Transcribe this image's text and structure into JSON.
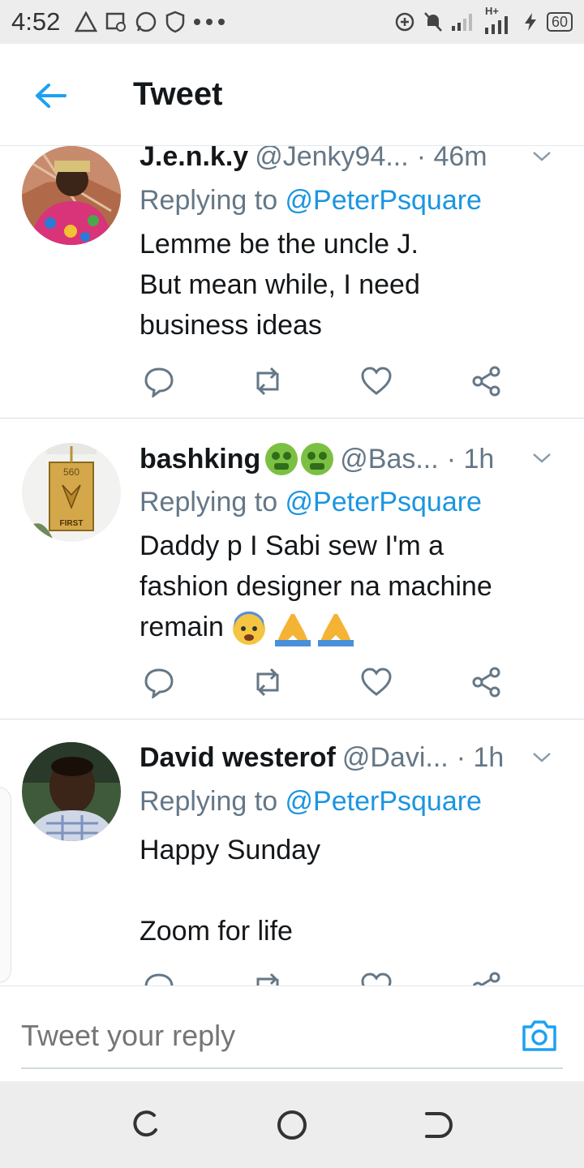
{
  "status_bar": {
    "time": "4:52",
    "left_icons": [
      "warning-icon",
      "image-icon",
      "whatsapp-icon",
      "shield-icon",
      "more-dots-icon"
    ],
    "right_icons": [
      "data-saver-icon",
      "mute-icon",
      "signal-icon",
      "signal-h-plus-icon",
      "charging-icon"
    ],
    "network_label": "H+",
    "battery": "60"
  },
  "app_bar": {
    "title": "Tweet"
  },
  "tweets": [
    {
      "name": "J.e.n.k.y",
      "handle": "@Jenky94...",
      "time": "· 46m",
      "replying_prefix": "Replying to ",
      "replying_to": "@PeterPsquare",
      "lines": [
        "Lemme be the uncle J.",
        "But mean while, I need",
        "business ideas"
      ]
    },
    {
      "name": "bashking",
      "name_emojis": [
        "money-mouth-face",
        "money-mouth-face"
      ],
      "handle": "@Bas...",
      "time": "· 1h",
      "replying_prefix": "Replying to ",
      "replying_to": "@PeterPsquare",
      "lines": [
        "Daddy p I Sabi sew I'm a",
        "fashion designer na machine",
        "remain"
      ],
      "line_emojis": [
        "anxious-face-with-sweat",
        "folded-hands",
        "folded-hands"
      ],
      "avatar_text": [
        "560",
        "FIRST"
      ]
    },
    {
      "name": "David westerof",
      "handle": "@Davi...",
      "time": "· 1h",
      "replying_prefix": "Replying to ",
      "replying_to": "@PeterPsquare",
      "lines": [
        "Happy Sunday",
        "",
        "Zoom for life"
      ]
    }
  ],
  "reply_bar": {
    "placeholder": "Tweet your reply"
  },
  "colors": {
    "accent": "#1da1f2",
    "text": "#14171a",
    "muted": "#657786",
    "link": "#1b95e0"
  }
}
